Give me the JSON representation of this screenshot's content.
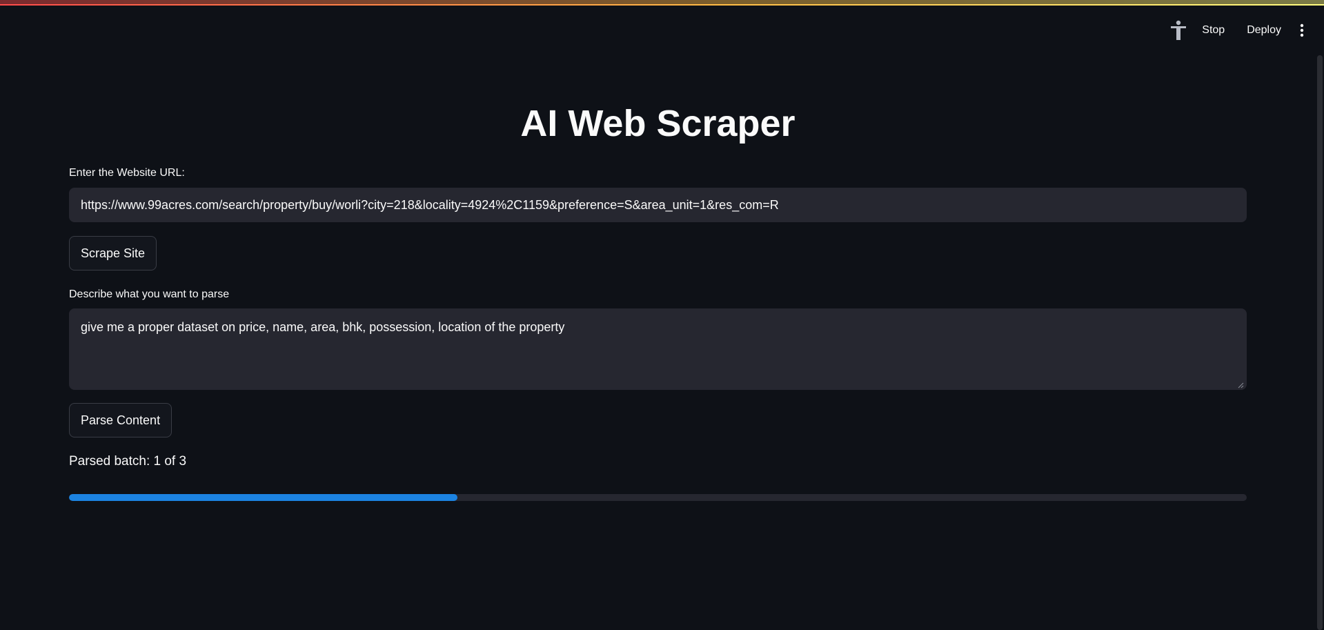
{
  "toolbar": {
    "stop_label": "Stop",
    "deploy_label": "Deploy"
  },
  "main": {
    "title": "AI Web Scraper",
    "url_label": "Enter the Website URL:",
    "url_value": "https://www.99acres.com/search/property/buy/worli?city=218&locality=4924%2C1159&preference=S&area_unit=1&res_com=R",
    "scrape_button": "Scrape Site",
    "parse_label": "Describe what you want to parse",
    "parse_value": "give me a proper dataset on price, name, area, bhk, possession, location of the property",
    "parse_button": "Parse Content",
    "status_text": "Parsed batch: 1 of 3",
    "progress": 0.33
  },
  "colors": {
    "background": "#0e1117",
    "input_bg": "#262730",
    "progress_fill": "#1c83e1",
    "text": "#fafafa"
  },
  "icons": {
    "accessibility": "accessibility-icon",
    "menu": "kebab-menu-icon"
  }
}
